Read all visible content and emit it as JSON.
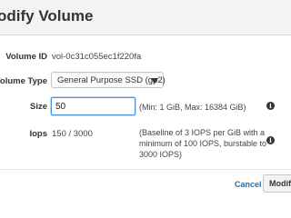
{
  "dialog": {
    "title": "odify Volume"
  },
  "form": {
    "volume_id": {
      "label": "Volume ID",
      "value": "vol-0c31c055ec1f220fa"
    },
    "volume_type": {
      "label": "Volume Type",
      "selected": "General Purpose SSD (gp2)"
    },
    "size": {
      "label": "Size",
      "value": "50",
      "hint": "(Min: 1 GiB, Max: 16384 GiB)"
    },
    "iops": {
      "label": "Iops",
      "value": "150 / 3000",
      "hint_line1": "(Baseline of 3 IOPS per GiB with a",
      "hint_line2": "minimum of 100 IOPS, burstable to",
      "hint_line3": "3000 IOPS)"
    }
  },
  "footer": {
    "cancel_label": "Cancel",
    "modify_label": "Modify"
  },
  "icons": {
    "info": "info-icon",
    "dropdown": "chevron-down-icon"
  },
  "colors": {
    "accent_link": "#1a6fb5",
    "focus_border": "#4a90d9",
    "header_bg": "#f2f3f3"
  }
}
